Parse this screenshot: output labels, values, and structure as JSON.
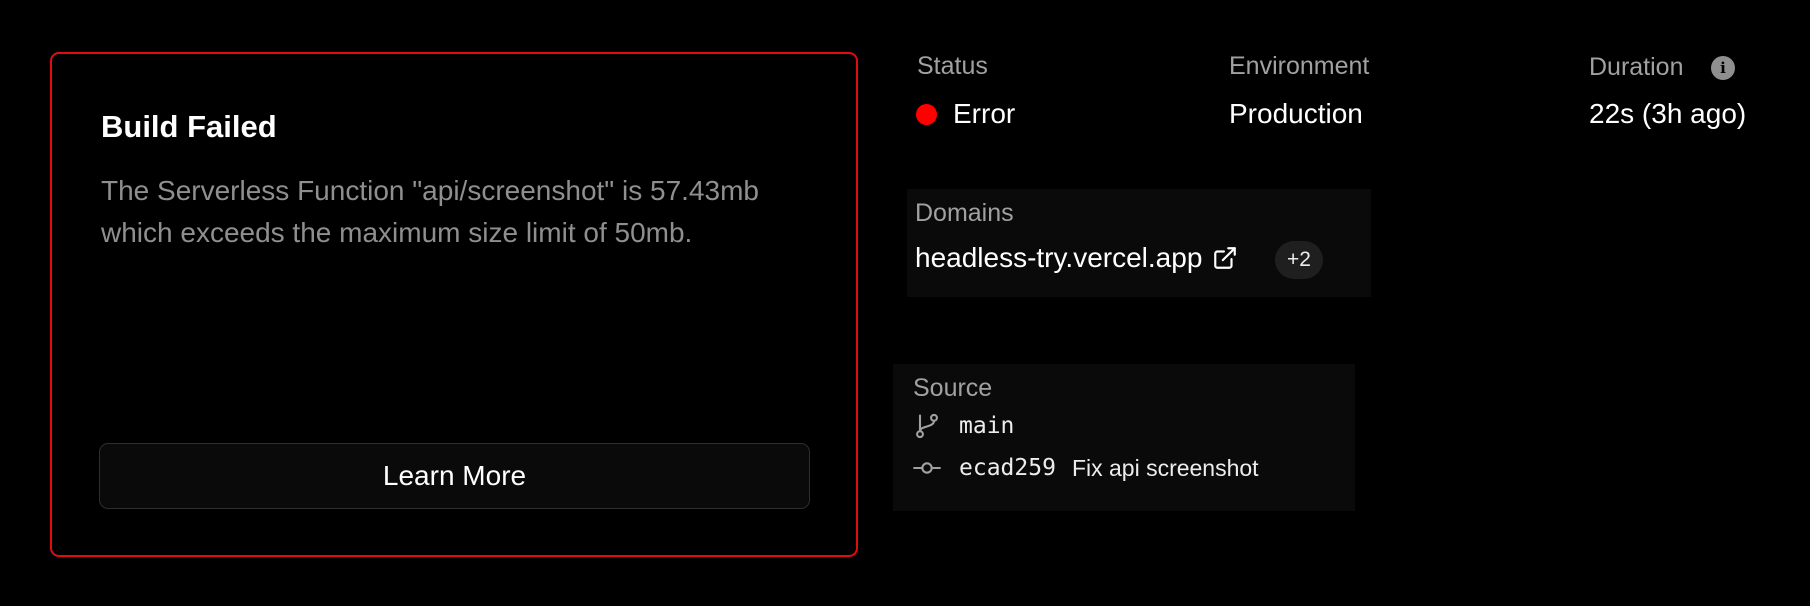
{
  "build_error": {
    "title": "Build Failed",
    "message": "The Serverless Function \"api/screenshot\" is 57.43mb which exceeds the maximum size limit of 50mb.",
    "learn_more_label": "Learn More"
  },
  "status": {
    "label": "Status",
    "value": "Error",
    "color": "#ff0000"
  },
  "environment": {
    "label": "Environment",
    "value": "Production"
  },
  "duration": {
    "label": "Duration",
    "value": "22s (3h ago)",
    "info_icon": "info-icon"
  },
  "domains": {
    "label": "Domains",
    "primary": "headless-try.vercel.app",
    "link_icon": "external-link-icon",
    "more_count": "+2"
  },
  "source": {
    "label": "Source",
    "branch_icon": "git-branch-icon",
    "branch": "main",
    "commit_icon": "git-commit-icon",
    "commit_hash": "ecad259",
    "commit_message": "Fix api screenshot"
  },
  "colors": {
    "background": "#000000",
    "error_border": "#e00d0d",
    "panel": "#0a0a0a",
    "muted_text": "#a1a1a1"
  }
}
